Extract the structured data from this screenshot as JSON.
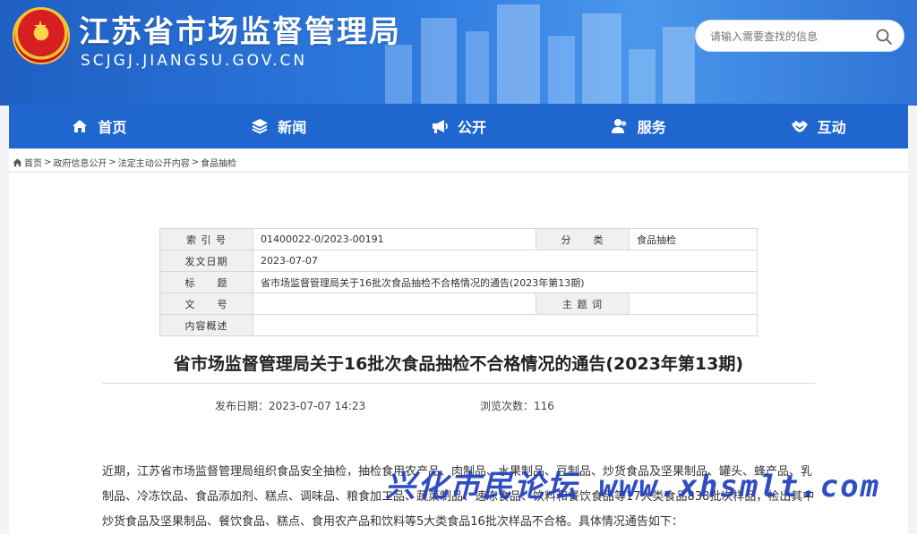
{
  "header": {
    "site_title": "江苏省市场监督管理局",
    "site_url": "SCJGJ.JIANGSU.GOV.CN",
    "search_placeholder": "请输入需要查找的信息"
  },
  "nav": {
    "items": [
      {
        "label": "首页",
        "icon": "home-icon"
      },
      {
        "label": "新闻",
        "icon": "layers-icon"
      },
      {
        "label": "公开",
        "icon": "megaphone-icon"
      },
      {
        "label": "服务",
        "icon": "people-icon"
      },
      {
        "label": "互动",
        "icon": "handshake-icon"
      }
    ]
  },
  "breadcrumb": {
    "items": [
      "首页",
      "政府信息公开",
      "法定主动公开内容",
      "食品抽检"
    ],
    "sep": ">"
  },
  "meta": {
    "index_label": "索 引 号",
    "index_value": "01400022-0/2023-00191",
    "category_label": "分　　类",
    "category_value": "食品抽检",
    "date_label": "发文日期",
    "date_value": "2023-07-07",
    "title_label": "标　　题",
    "title_value": "省市场监督管理局关于16批次食品抽检不合格情况的通告(2023年第13期)",
    "doc_no_label": "文　　号",
    "doc_no_value": "",
    "keywords_label": "主 题 词",
    "keywords_value": "",
    "summary_label": "内容概述",
    "summary_value": ""
  },
  "article": {
    "title": "省市场监督管理局关于16批次食品抽检不合格情况的通告(2023年第13期)",
    "publish_label": "发布日期：",
    "publish_time": "2023-07-07 14:23",
    "views_label": "浏览次数：",
    "views_count": "116",
    "paragraph": "近期，江苏省市场监督管理局组织食品安全抽检，抽检食用农产品、肉制品、水果制品、豆制品、炒货食品及坚果制品、罐头、蜂产品、乳制品、冷冻饮品、食品添加剂、糕点、调味品、粮食加工品、蔬菜制品、速冻食品、饮料和餐饮食品等17大类食品838批次样品，检出其中炒货食品及坚果制品、餐饮食品、糕点、食用农产品和饮料等5大类食品16批次样品不合格。具体情况通告如下："
  },
  "watermark": "兴化市民论坛 www.xhsmlt.com"
}
